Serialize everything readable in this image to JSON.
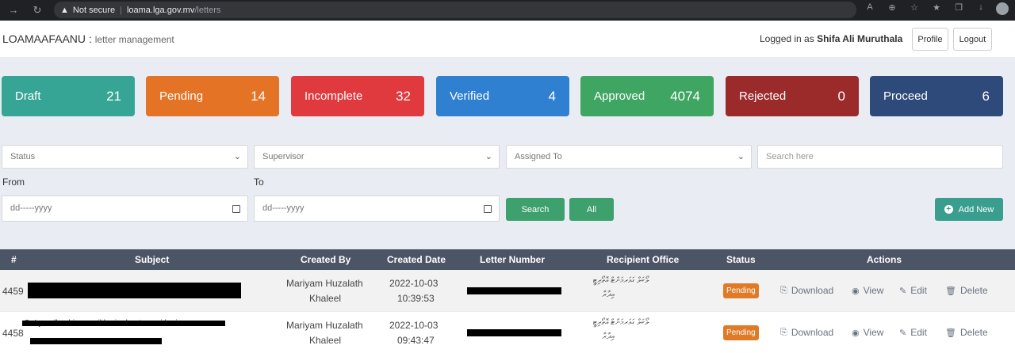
{
  "browser": {
    "security_label": "Not secure",
    "url_host": "loama.lga.gov.mv",
    "url_path": "/letters"
  },
  "header": {
    "brand": "LOAMAAFAANU",
    "brand_sep": " : ",
    "brand_sub": "letter management",
    "logged_prefix": "Logged in as ",
    "user": "Shifa Ali Muruthala",
    "profile_label": "Profile",
    "logout_label": "Logout"
  },
  "cards": [
    {
      "label": "Draft",
      "count": "21",
      "color": "#37a596"
    },
    {
      "label": "Pending",
      "count": "14",
      "color": "#e47325"
    },
    {
      "label": "Incomplete",
      "count": "32",
      "color": "#e0393e"
    },
    {
      "label": "Verified",
      "count": "4",
      "color": "#2f80d1"
    },
    {
      "label": "Approved",
      "count": "4074",
      "color": "#3ea563"
    },
    {
      "label": "Rejected",
      "count": "0",
      "color": "#9b2a2a"
    },
    {
      "label": "Proceed",
      "count": "6",
      "color": "#2d4a7a"
    }
  ],
  "filters": {
    "status_placeholder": "Status",
    "supervisor_placeholder": "Supervisor",
    "assigned_placeholder": "Assigned To",
    "search_placeholder": "Search here",
    "from_label": "From",
    "to_label": "To",
    "date_placeholder": "dd-----yyyy",
    "search_button": "Search",
    "all_button": "All",
    "add_new_button": "Add New"
  },
  "table": {
    "headers": [
      "#",
      "Subject",
      "Created By",
      "Created Date",
      "Letter Number",
      "Recipient Office",
      "Status",
      "Actions"
    ],
    "rows": [
      {
        "id": "4459",
        "subject": "",
        "created_by_1": "Mariyam Huzalath",
        "created_by_2": "Khaleel",
        "date": "2022-10-03",
        "time": "10:39:53",
        "recipient_1": "ލޯކަލް ގަވަރމަންޓް އޮތޯރިޓީ",
        "recipient_2": "އިދާރާ",
        "status": "Pending"
      },
      {
        "id": "4458",
        "subject": "G. Lyundhoshi council kurir akuatamaai kurir",
        "created_by_1": "Mariyam Huzalath",
        "created_by_2": "Khaleel",
        "date": "2022-10-03",
        "time": "09:43:47",
        "recipient_1": "ލޯކަލް ގަވަރމަންޓް އޮތޯރިޓީ",
        "recipient_2": "އިދާރާ",
        "status": "Pending"
      }
    ],
    "action_download": "Download",
    "action_view": "View",
    "action_edit": "Edit",
    "action_delete": "Delete"
  }
}
